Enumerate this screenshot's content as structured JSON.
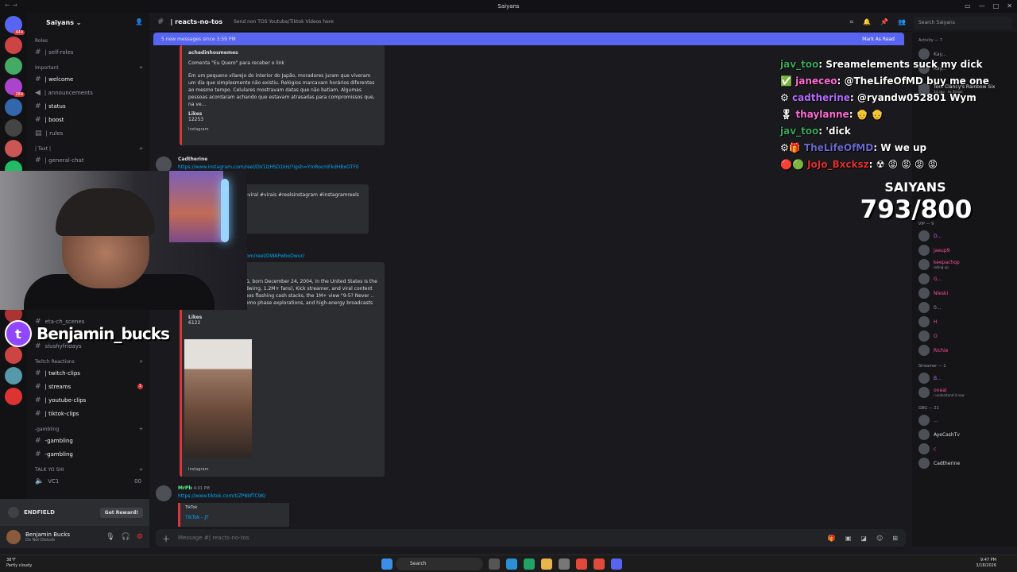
{
  "window": {
    "title": "Saiyans"
  },
  "server": {
    "name": "Saiyans"
  },
  "channel_list": {
    "roles_label": "Roles",
    "items": [
      {
        "label": "| self-roles",
        "category": "Roles"
      },
      {
        "label": "| welcome",
        "category": "Important"
      },
      {
        "label": "| announcements",
        "category": "Important"
      },
      {
        "label": "| status",
        "category": "Important"
      },
      {
        "label": "| boost",
        "category": "Important"
      },
      {
        "label": "| rules",
        "category": "Important"
      },
      {
        "label": "| general-chat",
        "category": "Text"
      }
    ],
    "cat_important": "Important",
    "cat_text": "| Text |",
    "cat_twitch": "Twitch Reactions",
    "twitch_items": [
      {
        "label": "| twitch-clips"
      },
      {
        "label": "| streams",
        "badge": "1"
      },
      {
        "label": "| youtube-clips"
      },
      {
        "label": "| tiktok-clips"
      }
    ],
    "cat_gambling": "-gambling",
    "gambling_items": [
      {
        "label": "-gambling"
      },
      {
        "label": "-gambling"
      }
    ],
    "extra_items": [
      {
        "label": "eta-ch_scenes"
      },
      {
        "label": "slushyfridays"
      }
    ],
    "cat_talk": "TALK YO SHI",
    "voice": {
      "label": "VC1",
      "count": "00"
    }
  },
  "endfield": {
    "label": "ENDFIELD",
    "button": "Get Reward!"
  },
  "user": {
    "name": "Benjamin Bucks",
    "status": "Do Not Disturb"
  },
  "header": {
    "channel": "| reacts-no-tos",
    "topic": "Send non TOS Youtube/Tiktok Videos here",
    "search_placeholder": "Search Saiyans"
  },
  "new_messages": {
    "text": "5 new messages since 3:59 PM",
    "mark_read": "Mark As Read"
  },
  "messages": {
    "embed1": {
      "author": "achadinhosmemes",
      "line1": "Comenta \"Eu Quero\" para receber o link",
      "body": "Em um pequeno vilarejo do interior do Japão, moradores juram que viveram um dia que simplesmente não existiu. Relógios marcavam horários diferentes ao mesmo tempo. Celulares mostravam datas que não batiam. Algumas pessoas acordaram achando que estavam atrasadas para compromissos que, na ve...",
      "likes_label": "Likes",
      "likes": "12253",
      "source": "Instagram"
    },
    "msg2": {
      "author": "Cadtherine",
      "link": "https://www.instagram.com/reel/DV1lzHSD1kH/?igsh=YmRocmFkdHBxOTF0",
      "tags": "#viral #virais #reelsinstagram #instagramreels"
    },
    "embed2": {
      "link": "om/reel/DWAPwboDwur/",
      "body": "G, born December 24, 2004, in the United States is the dwirrg, 1.2M+ fans), Kick streamer, and viral content eos flashing cash stacks, the 1M+ view \"9-5? Never .. emo phase explorations, and high-energy broadcasts",
      "likes_label": "Likes",
      "likes": "6122",
      "source": "Instagram"
    },
    "msg3": {
      "author": "MrPb",
      "time": "4:01 PM",
      "link": "https://www.tiktok.com/t/ZP8bfTC9K/",
      "embed_source": "TikTok",
      "embed_title": "TikTok - JT"
    }
  },
  "composer": {
    "placeholder": "Message #| reacts-no-tos"
  },
  "members": {
    "activity": "Activity — 7",
    "vip": "VIP — 9",
    "streamer": "Streamer — 2",
    "gbg": "GBG — 21",
    "list": [
      {
        "name": "Tom Clancy's Rainbow Six",
        "sub": "1d ago · 4x Streak"
      },
      {
        "name": "jaeup9",
        "sub": ""
      },
      {
        "name": "keepachop",
        "sub": "rolling up"
      },
      {
        "name": "Nleski",
        "sub": ""
      },
      {
        "name": "Richie",
        "sub": ""
      },
      {
        "name": "oneal",
        "sub": "i understand it now"
      },
      {
        "name": "AyeCashTv",
        "sub": ""
      },
      {
        "name": "Cadtherine",
        "sub": ""
      }
    ]
  },
  "overlay": {
    "handle": "Benjamin_bucks",
    "title": "SAIYANS",
    "count": "793/800",
    "chat": [
      {
        "user": "jav_too",
        "text": "Sreamelements suck my dick",
        "color": "#3ba55d"
      },
      {
        "user": "janeceo",
        "text": "@TheLifeOfMD buy me one",
        "color": "#ff6bd5"
      },
      {
        "user": "cadtherine",
        "text": "@ryandw052801 Wym",
        "color": "#b36bff"
      },
      {
        "user": "thaylanne",
        "text": "",
        "color": "#ff6bd5"
      },
      {
        "user": "jav_too",
        "text": "'dick",
        "color": "#3ba55d"
      },
      {
        "user": "TheLifeOfMD",
        "text": "W we up",
        "color": "#4a4a8a"
      },
      {
        "user": "JoJo_Bxcksz",
        "text": "",
        "color": "#e03030"
      }
    ]
  },
  "taskbar": {
    "weather_temp": "38°F",
    "weather_desc": "Partly cloudy",
    "search": "Search",
    "time": "9:47 PM",
    "date": "3/18/2026"
  }
}
